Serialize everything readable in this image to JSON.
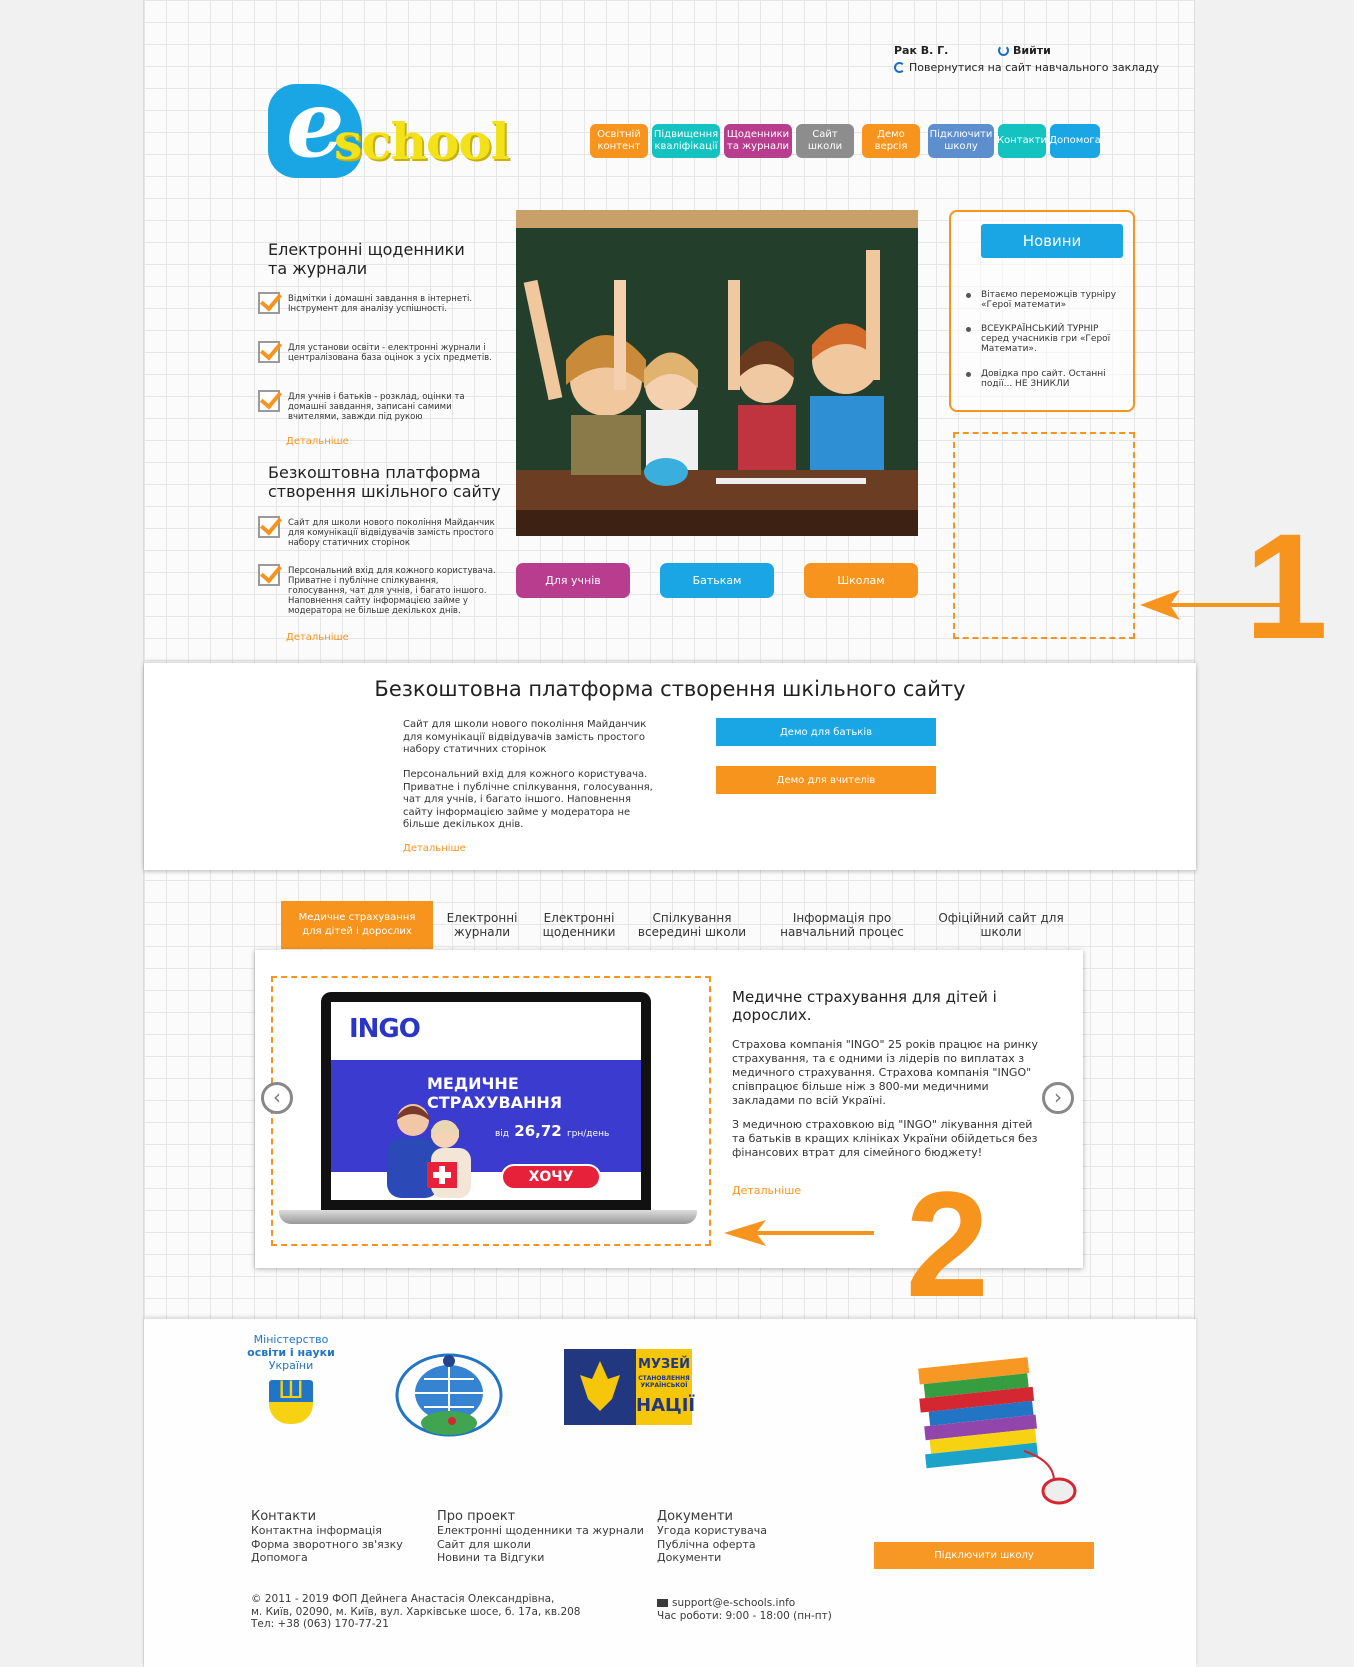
{
  "header": {
    "user_name": "Рак В. Г.",
    "logout_label": "Вийти",
    "back_link": "Повернутися на сайт навчального закладу",
    "logo_letter": "e",
    "logo_text": "school"
  },
  "nav": [
    {
      "label": "Освітній контент",
      "color": "#f7941d"
    },
    {
      "label": "Підвищення кваліфікації",
      "color": "#14c3c0"
    },
    {
      "label": "Щоденники та журнали",
      "color": "#b93d8f"
    },
    {
      "label": "Сайт школи",
      "color": "#8d8d8d"
    },
    {
      "label": "Демо версія",
      "color": "#f7941d"
    },
    {
      "label": "Підключити школу",
      "color": "#5d8fcf"
    },
    {
      "label": "Контакти",
      "color": "#14c3c0"
    },
    {
      "label": "Допомога",
      "color": "#1aa6e4"
    }
  ],
  "left": {
    "heading1": "Електронні щоденники та журнали",
    "items1": [
      "Відмітки і домашні завдання в інтернеті. Інструмент для аналізу успішності.",
      "Для установи освіти - електронні журнали і централізована база оцінок з усіх предметів.",
      "Для учнів і батьків - розклад, оцінки та домашні завдання, записані самими вчителями, завжди під рукою"
    ],
    "more1": "Детальніше",
    "heading2": "Безкоштовна платформа створення шкільного сайту",
    "items2": [
      "Сайт для школи нового покоління Майданчик для комунікації відвідувачів замість простого набору статичних сторінок",
      "Персональний вхід для кожного користувача. Приватне і публічне спілкування, голосування, чат для учнів, і багато іншого. Наповнення сайту інформацією займе у модератора не більше декількох днів."
    ],
    "more2": "Детальніше"
  },
  "roles": [
    {
      "label": "Для учнів",
      "color": "#b93d8f"
    },
    {
      "label": "Батькам",
      "color": "#1aa6e4"
    },
    {
      "label": "Школам",
      "color": "#f7941d"
    }
  ],
  "news": {
    "title": "Новини",
    "items": [
      "Вітаємо переможців турніру «Герої математи»",
      "ВСЕУКРАЇНСЬКИЙ ТУРНІР серед учасників гри «Герої Математи».",
      "Довідка про сайт. Останні події... НЕ ЗНИКЛИ"
    ]
  },
  "annotations": {
    "one": "1",
    "two": "2",
    "color": "#f7941d"
  },
  "platform": {
    "title": "Безкоштовна платформа створення шкільного сайту",
    "text1": "Сайт для школи нового покоління Майданчик для комунікації відвідувачів замість простого набору статичних сторінок",
    "text2": "Персональний вхід для кожного користувача. Приватне і публічне спілкування, голосування, чат для учнів, і багато іншого. Наповнення сайту інформацією займе у модератора не більше декількох днів.",
    "more": "Детальніше",
    "demo_parents": "Демо для батьків",
    "demo_teachers": "Демо для вчителів"
  },
  "tabs": [
    {
      "label": "Медичне страхування для дітей і дорослих",
      "active": true
    },
    {
      "label": "Електронні журнали",
      "active": false
    },
    {
      "label": "Електронні щоденники",
      "active": false
    },
    {
      "label": "Спілкування всередині школи",
      "active": false
    },
    {
      "label": "Інформація про навчальний процес",
      "active": false
    },
    {
      "label": "Офіційний сайт для школи",
      "active": false
    }
  ],
  "carousel": {
    "ad_logo": "INGO",
    "ad_headline_1": "МЕДИЧНЕ",
    "ad_headline_2": "СТРАХУВАННЯ",
    "ad_price_prefix": "від",
    "ad_price": "26,72",
    "ad_price_unit": "грн/день",
    "ad_button": "ХОЧУ",
    "title": "Медичне страхування для дітей і дорослих.",
    "text1": "Страхова компанія \"INGO\" 25 років працює на ринку страхування, та є одними із лідерів по виплатах з медичного страхування. Страхова компанія \"INGO\" співпрацює більше ніж з 800-ми медичними закладами по всій Україні.",
    "text2": "З медичною страховкою від \"INGO\" лікування дітей та батьків в кращих клініках України обійдеться без фінансових втрат для сімейного бюджету!",
    "more": "Детальніше",
    "prev": "‹",
    "next": "›"
  },
  "footer": {
    "ministry_1": "Міністерство",
    "ministry_2": "освіти і науки",
    "ministry_3": "України",
    "museum_1": "МУЗЕЙ",
    "museum_2": "СТАНОВЛЕННЯ УКРАЇНСЬКОЇ",
    "museum_3": "НАЦІЇ",
    "columns": [
      {
        "title": "Контакти",
        "links": [
          "Контактна інформація",
          "Форма зворотного зв'язку",
          "Допомога"
        ]
      },
      {
        "title": "Про проект",
        "links": [
          "Електронні щоденники та журнали",
          "Сайт для школи",
          "Новини та Відгуки"
        ]
      },
      {
        "title": "Документи",
        "links": [
          "Угода користувача",
          "Публічна оферта",
          "Документи"
        ]
      }
    ],
    "connect": "Підключити школу",
    "copyright_1": "© 2011 - 2019 ФОП Дейнега Анастасія Олександрівна,",
    "copyright_2": "м. Київ, 02090, м. Київ, вул. Харківське шосе, б. 17а, кв.208",
    "copyright_3": "Тел: +38 (063) 170-77-21",
    "email": "support@e-schools.info",
    "hours": "Час роботи: 9:00 - 18:00 (пн-пт)"
  }
}
